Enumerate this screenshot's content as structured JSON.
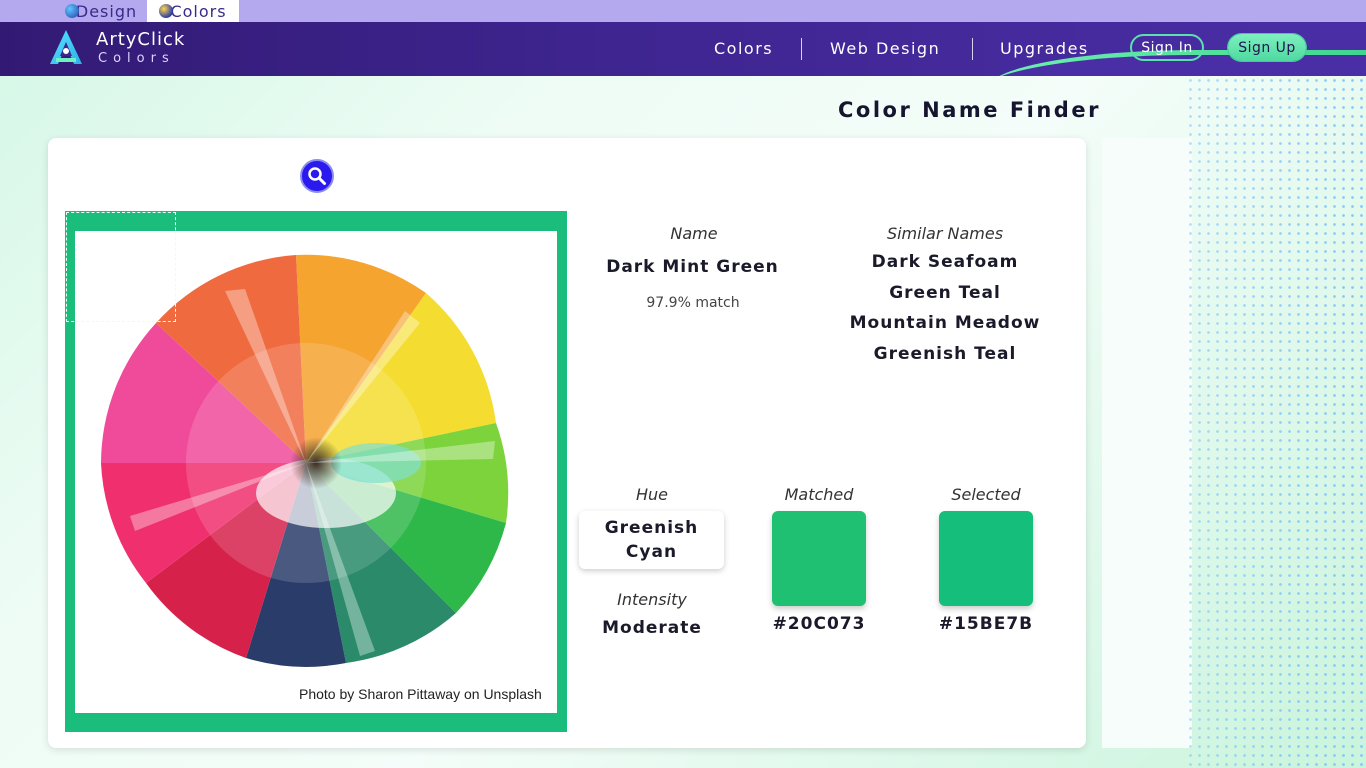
{
  "tabs": [
    {
      "label": "Design"
    },
    {
      "label": "Colors"
    }
  ],
  "header": {
    "brand_name": "ArtyClick",
    "brand_sub": "Colors",
    "nav": [
      "Colors",
      "Web Design",
      "Upgrades"
    ],
    "sign_in": "Sign In",
    "sign_up": "Sign Up"
  },
  "page_title": "Color Name Finder",
  "photo_credit": "Photo by Sharon Pittaway on Unsplash",
  "result": {
    "name_label": "Name",
    "name": "Dark Mint Green",
    "match": "97.9% match",
    "similar_label": "Similar Names",
    "similar": [
      "Dark Seafoam",
      "Green Teal",
      "Mountain Meadow",
      "Greenish Teal"
    ],
    "hue_label": "Hue",
    "hue": "Greenish Cyan",
    "intensity_label": "Intensity",
    "intensity": "Moderate",
    "matched_label": "Matched",
    "matched_hex": "#20C073",
    "selected_label": "Selected",
    "selected_hex": "#15BE7B"
  },
  "colors": {
    "header_bg": "#3e2590",
    "accent_green": "#1abd7c",
    "search_button": "#2a1aee",
    "matched": "#20C073",
    "selected": "#15BE7B"
  }
}
